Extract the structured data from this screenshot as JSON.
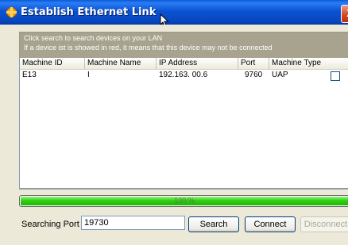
{
  "window": {
    "title": "Establish Ethernet Link",
    "close_glyph": "X"
  },
  "hints": [
    "Click search to search devices on your LAN",
    "If a device ist is showed in red, it means that this device may not be connected"
  ],
  "table": {
    "columns": [
      "Machine ID",
      "Machine Name",
      "IP Address",
      "Port",
      "Machine Type"
    ],
    "rows": [
      [
        "E13",
        "I",
        "192.163. 00.6",
        "9760",
        "UAP"
      ]
    ]
  },
  "progress": {
    "percent": 100,
    "label": "100 %"
  },
  "search_port": {
    "label": "Searching Port :",
    "value": "19730"
  },
  "buttons": {
    "search": "Search",
    "connect": "Connect",
    "disconnect": "Disconnect"
  },
  "colors": {
    "progress_fill": "#2fd011",
    "panel": "#a7a38e"
  }
}
